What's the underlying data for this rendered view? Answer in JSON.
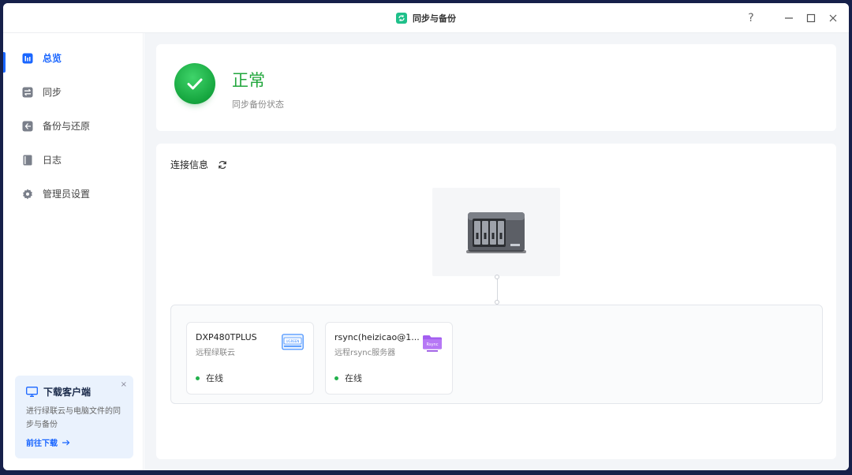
{
  "window": {
    "title": "同步与备份",
    "help_label": "?",
    "minimize_label": "—",
    "maximize_label": "☐",
    "close_label": "✕"
  },
  "sidebar": {
    "items": [
      {
        "label": "总览",
        "icon": "chart-bars-icon",
        "active": true
      },
      {
        "label": "同步",
        "icon": "sync-arrows-icon",
        "active": false
      },
      {
        "label": "备份与还原",
        "icon": "backup-restore-icon",
        "active": false
      },
      {
        "label": "日志",
        "icon": "log-book-icon",
        "active": false
      },
      {
        "label": "管理员设置",
        "icon": "gear-icon",
        "active": false
      }
    ],
    "promo": {
      "title": "下载客户端",
      "description": "进行绿联云与电脑文件的同步与备份",
      "link": "前往下载",
      "close": "×"
    }
  },
  "status": {
    "title": "正常",
    "subtitle": "同步备份状态",
    "color": "#21a63c"
  },
  "connection": {
    "header": "连接信息",
    "targets": [
      {
        "name": "DXP480TPLUS",
        "type": "远程绿联云",
        "status": "在线",
        "logo": "ugreen-logo-icon",
        "logo_text": "UGREEN"
      },
      {
        "name": "rsync(heizicao@1...",
        "type": "远程rsync服务器",
        "status": "在线",
        "logo": "rsync-folder-icon",
        "logo_text": "Rsync"
      }
    ]
  },
  "colors": {
    "accent": "#1a66ff",
    "online": "#22b14c"
  }
}
